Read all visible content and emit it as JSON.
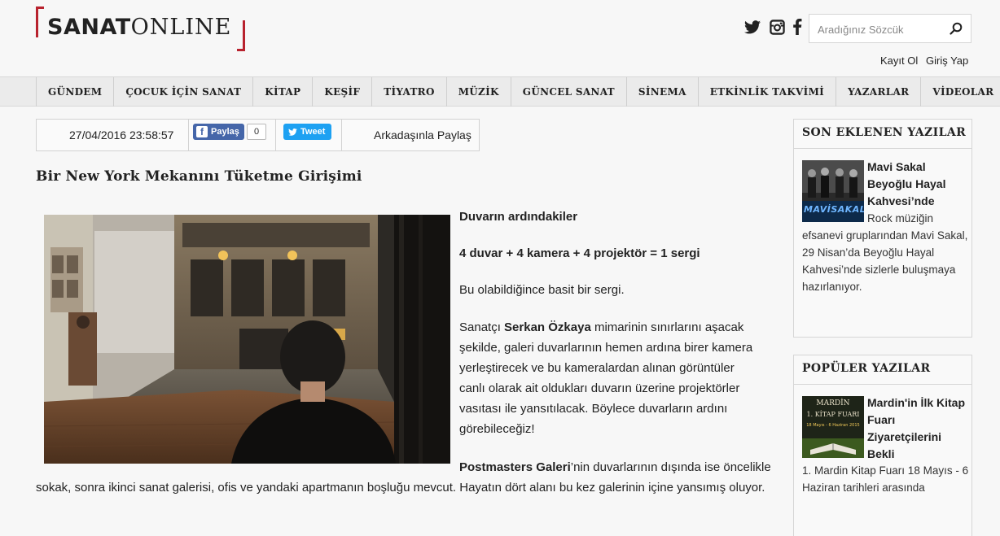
{
  "header": {
    "logo_bold": "SANAT",
    "logo_light": "ONLINE",
    "social_icons": [
      "twitter-icon",
      "instagram-icon",
      "facebook-icon"
    ],
    "search_placeholder": "Aradığınız Sözcük",
    "register_label": "Kayıt Ol",
    "login_label": "Giriş Yap"
  },
  "nav": {
    "items": [
      "GÜNDEM",
      "ÇOCUK İÇİN SANAT",
      "KİTAP",
      "KEŞİF",
      "TİYATRO",
      "MÜZİK",
      "GÜNCEL SANAT",
      "SİNEMA",
      "ETKİNLİK TAKVİMİ",
      "YAZARLAR",
      "VİDEOLAR"
    ]
  },
  "share": {
    "date": "27/04/2016 23:58:57",
    "fb_label": "Paylaş",
    "fb_count": "0",
    "tweet_label": "Tweet",
    "friend_label": "Arkadaşınla Paylaş"
  },
  "article": {
    "title": "Bir New York Mekanını Tüketme Girişimi",
    "heading1": "Duvarın ardındakiler",
    "heading2": "4 duvar + 4 kamera + 4 projektör = 1 sergi",
    "p1": "Bu olabildiğince basit bir sergi.",
    "p2_prefix": "Sanatçı ",
    "p2_name": "Serkan Özkaya",
    "p2_line1_rest": " mimarinin sınırlarını aşacak",
    "p2_line2": "şekilde, galeri duvarlarının hemen ardına birer kamera",
    "p2_line3": "yerleştirecek ve bu kameralardan alınan görüntüler",
    "p2_line4": "canlı olarak ait oldukları duvarın üzerine projektörler",
    "p2_line5": "vasıtası ile yansıtılacak. Böylece duvarların ardını",
    "p2_line6": "görebileceğiz!",
    "p3_name": "Postmasters Galeri",
    "p3_rest": "’nin duvarlarının dışında ise öncelikle sokak, sonra ikinci sanat galerisi, ofis ve yandaki apartmanın boşluğu mevcut. Hayatın dört alanı bu kez galerinin içine yansımış oluyor."
  },
  "sidebar": {
    "recent": {
      "heading": "SON EKLENEN YAZILAR",
      "title": "Mavi Sakal Beyoğlu Hayal Kahvesi’nde",
      "thumb_text": "MAVİSAKAL",
      "summary_first": "Rock müziğin",
      "summary_rest": "efsanevi gruplarından Mavi Sakal, 29 Nisan’da Beyoğlu Hayal Kahvesi’nde sizlerle buluşmaya hazırlanıyor."
    },
    "popular": {
      "heading": "POPÜLER YAZILAR",
      "title": "Mardin'in İlk Kitap Fuarı Ziyaretçilerini Bekli",
      "thumb_line1": "MARDİN",
      "thumb_line2": "1. KİTAP FUARI",
      "thumb_line3": "18 Mayıs - 6 Haziran 2015",
      "summary": "1. Mardin Kitap Fuarı 18 Mayıs - 6 Haziran tarihleri arasında"
    }
  },
  "colors": {
    "brand_red": "#b8222e",
    "facebook": "#4566a9",
    "twitter": "#1da1f2",
    "nav_bg": "#ebebeb"
  }
}
